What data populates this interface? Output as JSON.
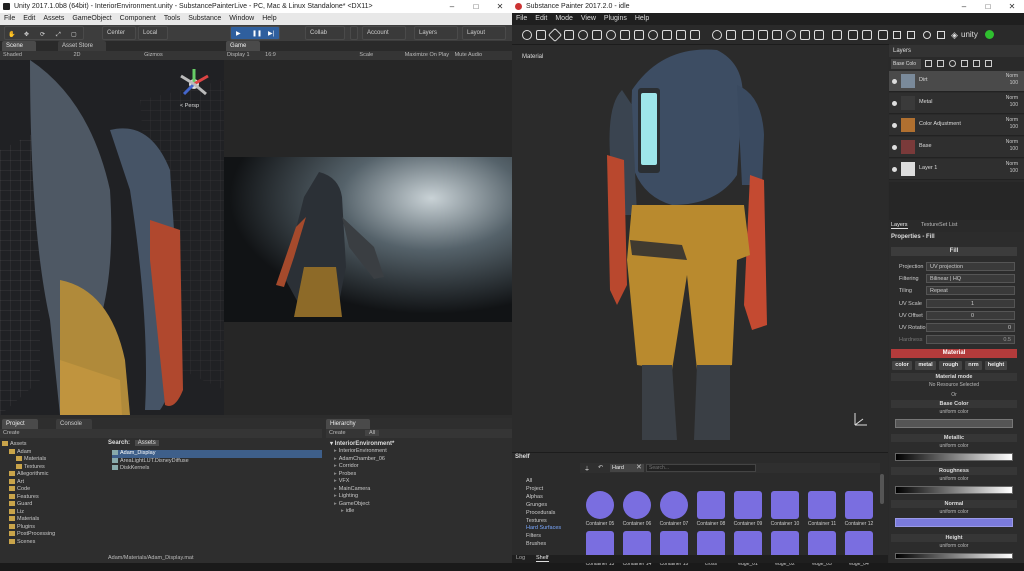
{
  "unity": {
    "title": "Unity 2017.1.0b8 (64bit) - InteriorEnvironment.unity - SubstancePainterLive - PC, Mac & Linux Standalone* <DX11>",
    "menu": [
      "File",
      "Edit",
      "Assets",
      "GameObject",
      "Component",
      "Tools",
      "Substance",
      "Window",
      "Help"
    ],
    "toolbar": {
      "center": "Center",
      "local": "Local",
      "collab": "Collab",
      "account": "Account",
      "layers": "Layers",
      "layout": "Layout"
    },
    "scene_tabs": {
      "scene": "Scene",
      "asset_store": "Asset Store",
      "game": "Game"
    },
    "scene_bar": {
      "shading": "Shaded",
      "mode": "2D",
      "gizmos": "Gizmos",
      "persp": "< Persp"
    },
    "game_bar": {
      "display": "Display 1",
      "aspect": "16:9",
      "scale": "Scale",
      "maximize": "Maximize On Play",
      "mute": "Mute Audio"
    },
    "bottom_tabs": {
      "project": "Project",
      "console": "Console",
      "hierarchy": "Hierarchy"
    },
    "project": {
      "create": "Create",
      "search_label": "Search:",
      "search_scope": "Assets",
      "tree": [
        "Assets",
        "Adam",
        "Materials",
        "Textures",
        "Allegorithmic",
        "Art",
        "Code",
        "Features",
        "Guard",
        "Liz",
        "Materials",
        "Plugins",
        "PostProcessing",
        "Scenes"
      ],
      "files": [
        "Adam_Display",
        "AreaLightLUT.DisneyDiffuse",
        "DiskKernels"
      ],
      "path": "Adam/Materials/Adam_Display.mat"
    },
    "hierarchy": {
      "create": "Create",
      "search": "All",
      "scene": "InteriorEnvironment*",
      "items": [
        "InteriorEnvironment",
        "AdamChamber_06",
        "Corridor",
        "Probes",
        "VFX",
        "MainCamera",
        "Lighting",
        "GameObject",
        "idle"
      ]
    }
  },
  "sp": {
    "title": "Substance Painter 2017.2.0 - idle",
    "menu": [
      "File",
      "Edit",
      "Mode",
      "View",
      "Plugins",
      "Help"
    ],
    "viewport_label": "Material",
    "unity_label": "unity",
    "layers_title": "Layers",
    "blend_default": "Base Colo",
    "layers": [
      {
        "name": "Dirt",
        "mode": "Norm",
        "opacity": "100",
        "color": "#7a8a9a"
      },
      {
        "name": "Metal",
        "mode": "Norm",
        "opacity": "100",
        "color": "#3a3a3a"
      },
      {
        "name": "Color Adjustment",
        "mode": "Norm",
        "opacity": "100",
        "color": "#b07030"
      },
      {
        "name": "Base",
        "mode": "Norm",
        "opacity": "100",
        "color": "#7a3a3a"
      },
      {
        "name": "Layer 1",
        "mode": "Norm",
        "opacity": "100",
        "color": "#dddddd"
      }
    ],
    "layer_tabs": {
      "layers": "Layers",
      "textureset": "TextureSet List"
    },
    "properties": {
      "title": "Properties - Fill",
      "fill": "Fill",
      "projection_label": "Projection",
      "projection": "UV projection",
      "filtering_label": "Filtering",
      "filtering": "Bilinear | HQ",
      "tiling_label": "Tiling",
      "tiling": "Repeat",
      "uvscale_label": "UV Scale",
      "uvscale": "1",
      "uvoffset_label": "UV Offset",
      "uvoffset": "0",
      "uvrotation_label": "UV Rotation",
      "uvrotation": "0",
      "hardness_label": "Hardness",
      "hardness": "0.5"
    },
    "material": {
      "title": "Material",
      "channels": [
        "color",
        "metal",
        "rough",
        "nrm",
        "height"
      ],
      "mode_title": "Material mode",
      "mode_value": "No Resource Selected",
      "or": "Or",
      "base_color": "Base Color",
      "uniform": "uniform color",
      "metallic": "Metallic",
      "roughness": "Roughness",
      "normal": "Normal",
      "height": "Height"
    },
    "shelf": {
      "title": "Shelf",
      "categories": [
        "All",
        "Project",
        "Alphas",
        "Grunges",
        "Procedurals",
        "Textures",
        "Hard Surfaces",
        "Filters",
        "Brushes"
      ],
      "filter": "Hard",
      "search_placeholder": "Search...",
      "row1": [
        "Container 05",
        "Container 06",
        "Container 07",
        "Container 08",
        "Container 09",
        "Container 10",
        "Container 11",
        "Container 12"
      ],
      "row2": [
        "Container 13",
        "Container 14",
        "Container 15",
        "cross",
        "edge_01",
        "edge_02",
        "edge_03",
        "edge_04"
      ],
      "bottom_tabs": [
        "Log",
        "Shelf"
      ]
    },
    "colors": {
      "accent_red": "#b33b3b",
      "normal_blue": "#7b7bdc",
      "shelf_blue": "#7a6ee0"
    }
  }
}
